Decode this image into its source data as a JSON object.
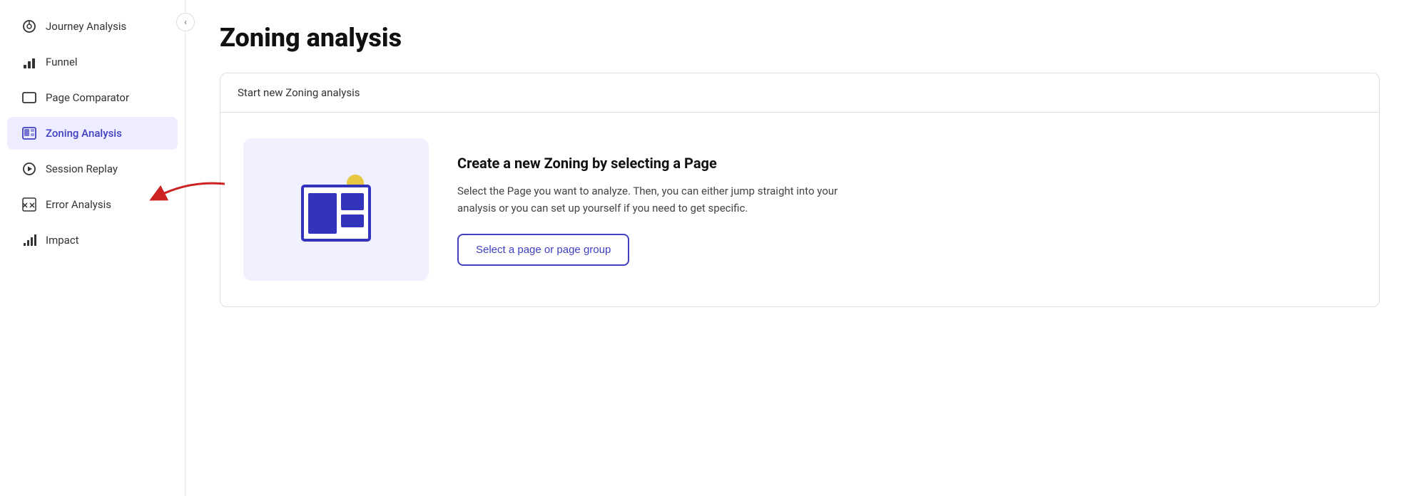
{
  "sidebar": {
    "collapse_label": "‹",
    "items": [
      {
        "id": "journey-analysis",
        "label": "Journey Analysis",
        "active": false,
        "icon": "journey-icon"
      },
      {
        "id": "funnel",
        "label": "Funnel",
        "active": false,
        "icon": "funnel-icon"
      },
      {
        "id": "page-comparator",
        "label": "Page Comparator",
        "active": false,
        "icon": "comparator-icon"
      },
      {
        "id": "zoning-analysis",
        "label": "Zoning Analysis",
        "active": true,
        "icon": "zoning-icon"
      },
      {
        "id": "session-replay",
        "label": "Session Replay",
        "active": false,
        "icon": "replay-icon"
      },
      {
        "id": "error-analysis",
        "label": "Error Analysis",
        "active": false,
        "icon": "error-icon"
      },
      {
        "id": "impact",
        "label": "Impact",
        "active": false,
        "icon": "impact-icon"
      }
    ]
  },
  "main": {
    "page_title": "Zoning analysis",
    "card_header": "Start new Zoning analysis",
    "create_title": "Create a new Zoning by selecting a Page",
    "create_description": "Select the Page you want to analyze. Then, you can either jump straight into your analysis or you can set up yourself if you need to get specific.",
    "select_button_label": "Select a page or page group"
  },
  "colors": {
    "active_bg": "#ededff",
    "active_text": "#4040c0",
    "button_border": "#4040c0",
    "button_text": "#4040c0",
    "illustration_bg": "#f0f0ff",
    "icon_blue": "#3333bb",
    "icon_yellow": "#e8c840",
    "arrow_color": "#cc2222"
  }
}
